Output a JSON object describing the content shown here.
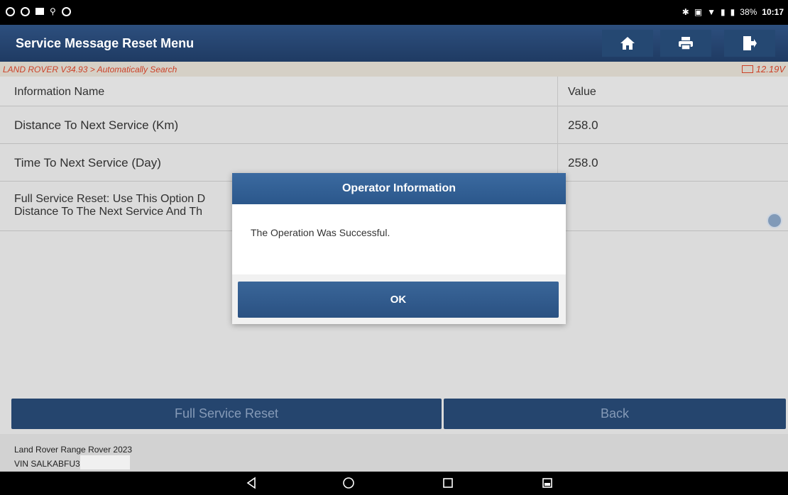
{
  "status_bar": {
    "battery": "38%",
    "clock": "10:17"
  },
  "header": {
    "title": "Service Message Reset Menu",
    "icons": [
      "home-icon",
      "print-icon",
      "exit-icon"
    ]
  },
  "breadcrumb": {
    "path": "LAND ROVER V34.93 > Automatically Search",
    "voltage": "12.19V"
  },
  "table": {
    "columns": [
      "Information Name",
      "Value"
    ],
    "rows": [
      {
        "name": "Distance To Next Service (Km)",
        "value": "258.0"
      },
      {
        "name": "Time To Next Service (Day)",
        "value": "258.0"
      },
      {
        "name_line1": "Full Service Reset: Use This Option D",
        "name_line2": "Distance To The Next Service And Th",
        "value": ""
      }
    ]
  },
  "buttons": {
    "full_service_reset": "Full Service Reset",
    "back": "Back"
  },
  "footer": {
    "vehicle": "Land Rover Range Rover 2023",
    "vin": "VIN SALKABFU3"
  },
  "dialog": {
    "title": "Operator Information",
    "message": "The Operation Was Successful.",
    "ok_label": "OK"
  },
  "colors": {
    "header_bg": "#1f3b63",
    "breadcrumb_text": "#d9462b",
    "button_bg": "#284a75",
    "dialog_title_bg": "#2b578b"
  }
}
